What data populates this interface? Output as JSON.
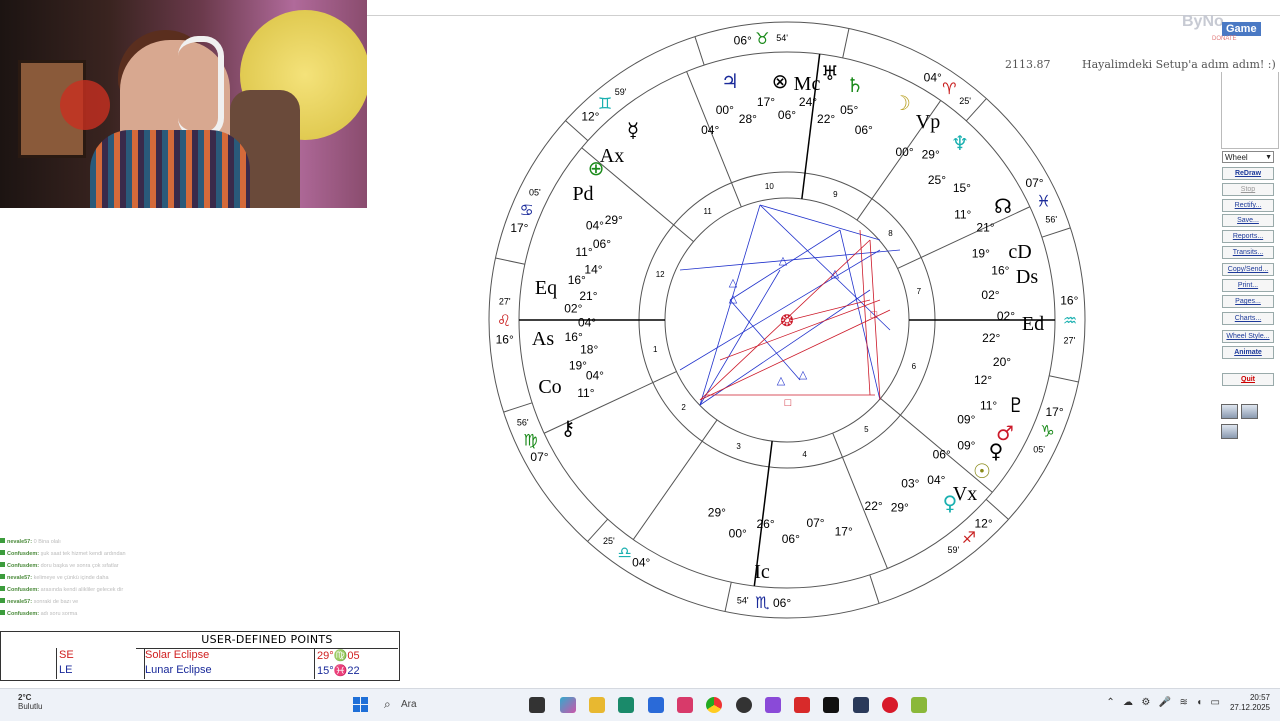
{
  "window": {
    "title_label": "2113.87",
    "subtitle": "Hayalimdeki Setup'a adım adım! :)",
    "logo_text": "ByNo",
    "logo_badge": "Game",
    "logo_donate": "DONATE"
  },
  "sidebar": {
    "chart_style_select": "Wheel",
    "buttons": [
      {
        "label": "ReDraw",
        "style": "bold"
      },
      {
        "label": "Stop",
        "style": "dim"
      },
      {
        "label": "Rectify...",
        "style": ""
      },
      {
        "label": "Save...",
        "style": ""
      },
      {
        "label": "Reports...",
        "style": ""
      },
      {
        "label": "Transits...",
        "style": ""
      },
      {
        "label": "Copy/Send...",
        "style": ""
      },
      {
        "label": "Print...",
        "style": ""
      },
      {
        "label": "Pages...",
        "style": ""
      },
      {
        "label": "Charts...",
        "style": ""
      },
      {
        "label": "Wheel Style...",
        "style": ""
      },
      {
        "label": "Animate",
        "style": "bold"
      },
      {
        "label": "Quit",
        "style": "red"
      }
    ]
  },
  "wheel": {
    "outer_degrees": [
      {
        "deg": "06°",
        "min": "54'",
        "sign": "taurus"
      },
      {
        "deg": "12°",
        "min": "59'",
        "sign": "gemini"
      },
      {
        "deg": "17°",
        "min": "05'",
        "sign": "cancer"
      },
      {
        "deg": "16°",
        "min": "27'",
        "sign": "leo"
      },
      {
        "deg": "07°",
        "min": "56'",
        "sign": "virgo"
      },
      {
        "deg": "04°",
        "min": "25'",
        "sign": "libra"
      },
      {
        "deg": "06°",
        "min": "54'",
        "sign": "scorpio"
      },
      {
        "deg": "12°",
        "min": "59'",
        "sign": "sagittarius"
      },
      {
        "deg": "17°",
        "min": "05'",
        "sign": "capricorn"
      },
      {
        "deg": "16°",
        "min": "27'",
        "sign": "aquarius"
      },
      {
        "deg": "07°",
        "min": "56'",
        "sign": "pisces"
      },
      {
        "deg": "04°",
        "min": "25'",
        "sign": "aries"
      }
    ],
    "angles": [
      "Mc",
      "Ic",
      "As",
      "Ds",
      "Vx",
      "Ed",
      "Eq",
      "Ax",
      "Pd",
      "Co",
      "Vp",
      "cD"
    ],
    "house_numbers": [
      "1",
      "2",
      "3",
      "4",
      "5",
      "6",
      "7",
      "8",
      "9",
      "10",
      "11",
      "12"
    ],
    "placements_top": [
      "04°",
      "00°",
      "28°",
      "17°",
      "06°",
      "24°",
      "22°",
      "05°",
      "06°"
    ],
    "placements_left": [
      "29°",
      "04°",
      "06°",
      "11°",
      "14°",
      "16°",
      "21°",
      "02°",
      "04°",
      "16°",
      "18°",
      "19°",
      "04°",
      "11°"
    ],
    "placements_right": [
      "00°",
      "29°",
      "25°",
      "15°",
      "11°",
      "21°",
      "19°",
      "16°",
      "02°",
      "02°",
      "22°",
      "20°",
      "12°",
      "11°",
      "09°",
      "09°",
      "06°",
      "04°",
      "03°",
      "29°",
      "22°"
    ],
    "placements_bottom": [
      "29°",
      "00°",
      "26°",
      "06°",
      "07°",
      "17°"
    ]
  },
  "user_defined_points": {
    "title": "USER-DEFINED POINTS",
    "rows": [
      {
        "code": "SE",
        "name": "Solar Eclipse",
        "position": "29°♍05",
        "color": "#d02020"
      },
      {
        "code": "LE",
        "name": "Lunar Eclipse",
        "position": "15°♓22",
        "color": "#1a2a9a"
      }
    ]
  },
  "chat": {
    "messages": [
      {
        "user": "nevale57:",
        "text": "0 Bina olalı"
      },
      {
        "user": "Confusdem:",
        "text": "şuk saat tek hizmet kendi ardından"
      },
      {
        "user": "Confusdem:",
        "text": "doru başka ve sonra çok sıfatlar"
      },
      {
        "user": "nevale57:",
        "text": "kelimeye ve çünkü içinde daha"
      },
      {
        "user": "Confusdem:",
        "text": "arasında kendi alikliler gelecek dir"
      },
      {
        "user": "nevale57:",
        "text": "sonraki de bazı ve"
      },
      {
        "user": "Confusdem:",
        "text": "adı soru sorma"
      }
    ]
  },
  "taskbar": {
    "weather_temp": "2°C",
    "weather_desc": "Bulutlu",
    "search_label": "Ara",
    "time": "20:57",
    "date": "27.12.2025"
  },
  "colors": {
    "fire": "#c81e1e",
    "earth": "#1a8a1a",
    "air": "#1ab0b0",
    "water": "#1a2a9a",
    "aspect_blue": "#2233cc",
    "aspect_red": "#cc1a2a"
  }
}
